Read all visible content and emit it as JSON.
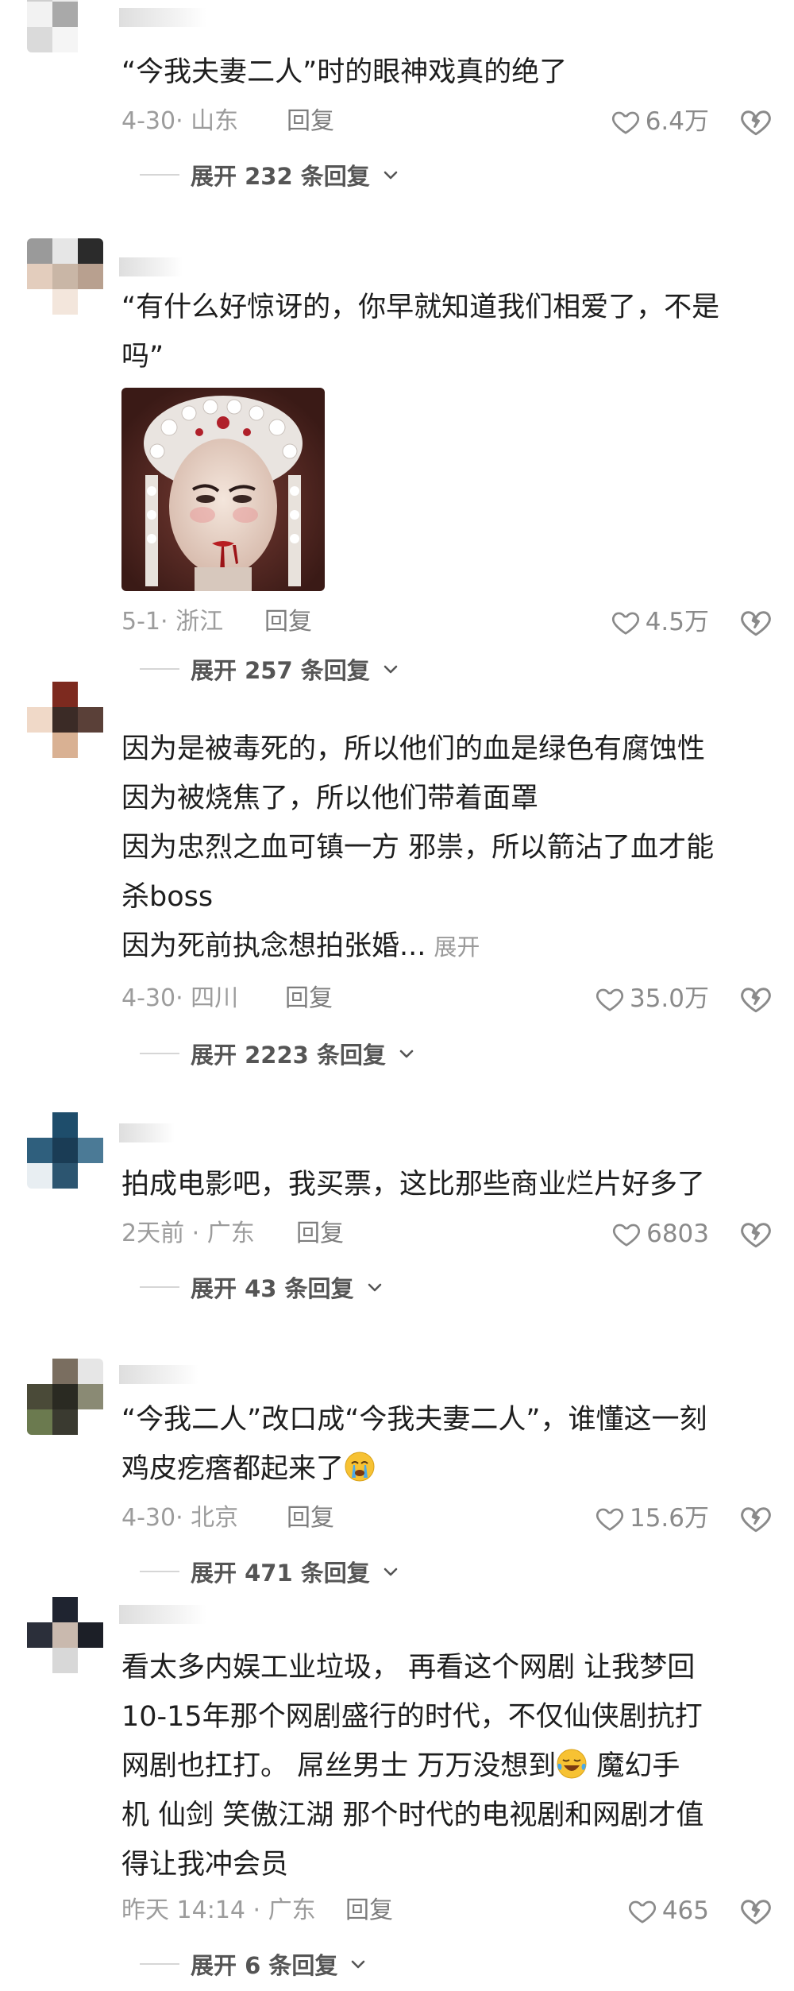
{
  "comments": [
    {
      "text_lines": [
        "“今我夫妻二人”时的眼神戏真的绝了"
      ],
      "date_location": "4-30· 山东",
      "reply_label": "回复",
      "likes": "6.4万",
      "replies_label": "展开 232 条回复"
    },
    {
      "text_lines": [
        "“有什么好惊讶的，你早就知道我们相爱了，不是",
        "吗”"
      ],
      "has_image": true,
      "date_location": "5-1· 浙江",
      "reply_label": "回复",
      "likes": "4.5万",
      "replies_label": "展开 257 条回复"
    },
    {
      "text_lines": [
        "因为是被毒死的，所以他们的血是绿色有腐蚀性",
        "因为被烧焦了，所以他们带着面罩",
        "因为忠烈之血可镇一方 邪祟，所以箭沾了血才能",
        "杀boss",
        "因为死前执念想拍张婚..."
      ],
      "more_label": "展开",
      "date_location": "4-30· 四川",
      "reply_label": "回复",
      "likes": "35.0万",
      "replies_label": "展开 2223 条回复"
    },
    {
      "text_lines": [
        "拍成电影吧，我买票，这比那些商业烂片好多了"
      ],
      "date_location": "2天前 · 广东",
      "reply_label": "回复",
      "likes": "6803",
      "replies_label": "展开 43 条回复"
    },
    {
      "text_lines": [
        "“今我二人”改口成“今我夫妻二人”，谁懂这一刻",
        "鸡皮疙瘩都起来了"
      ],
      "emoji": "crying-emoji",
      "date_location": "4-30· 北京",
      "reply_label": "回复",
      "likes": "15.6万",
      "replies_label": "展开 471 条回复"
    },
    {
      "text_lines": [
        "看太多内娱工业垃圾， 再看这个网剧 让我梦回",
        "10-15年那个网剧盛行的时代，不仅仙侠剧抗打",
        "网剧也扛打。 屌丝男士  万万没想到",
        "机 仙剑  笑傲江湖 那个时代的电视剧和网剧才值",
        "得让我冲会员"
      ],
      "line3_tail": " 魔幻手",
      "emoji": "laughing-tears-emoji",
      "date_location": "昨天 14:14 · 广东",
      "reply_label": "回复",
      "likes": "465",
      "replies_label": "展开 6 条回复"
    }
  ],
  "icons": {
    "like": "heart-outline-icon",
    "dislike": "broken-heart-icon",
    "expand": "chevron-down-icon"
  },
  "colors": {
    "text": "#1e1e1e",
    "meta": "#9c9c9c",
    "expand": "#555555"
  }
}
